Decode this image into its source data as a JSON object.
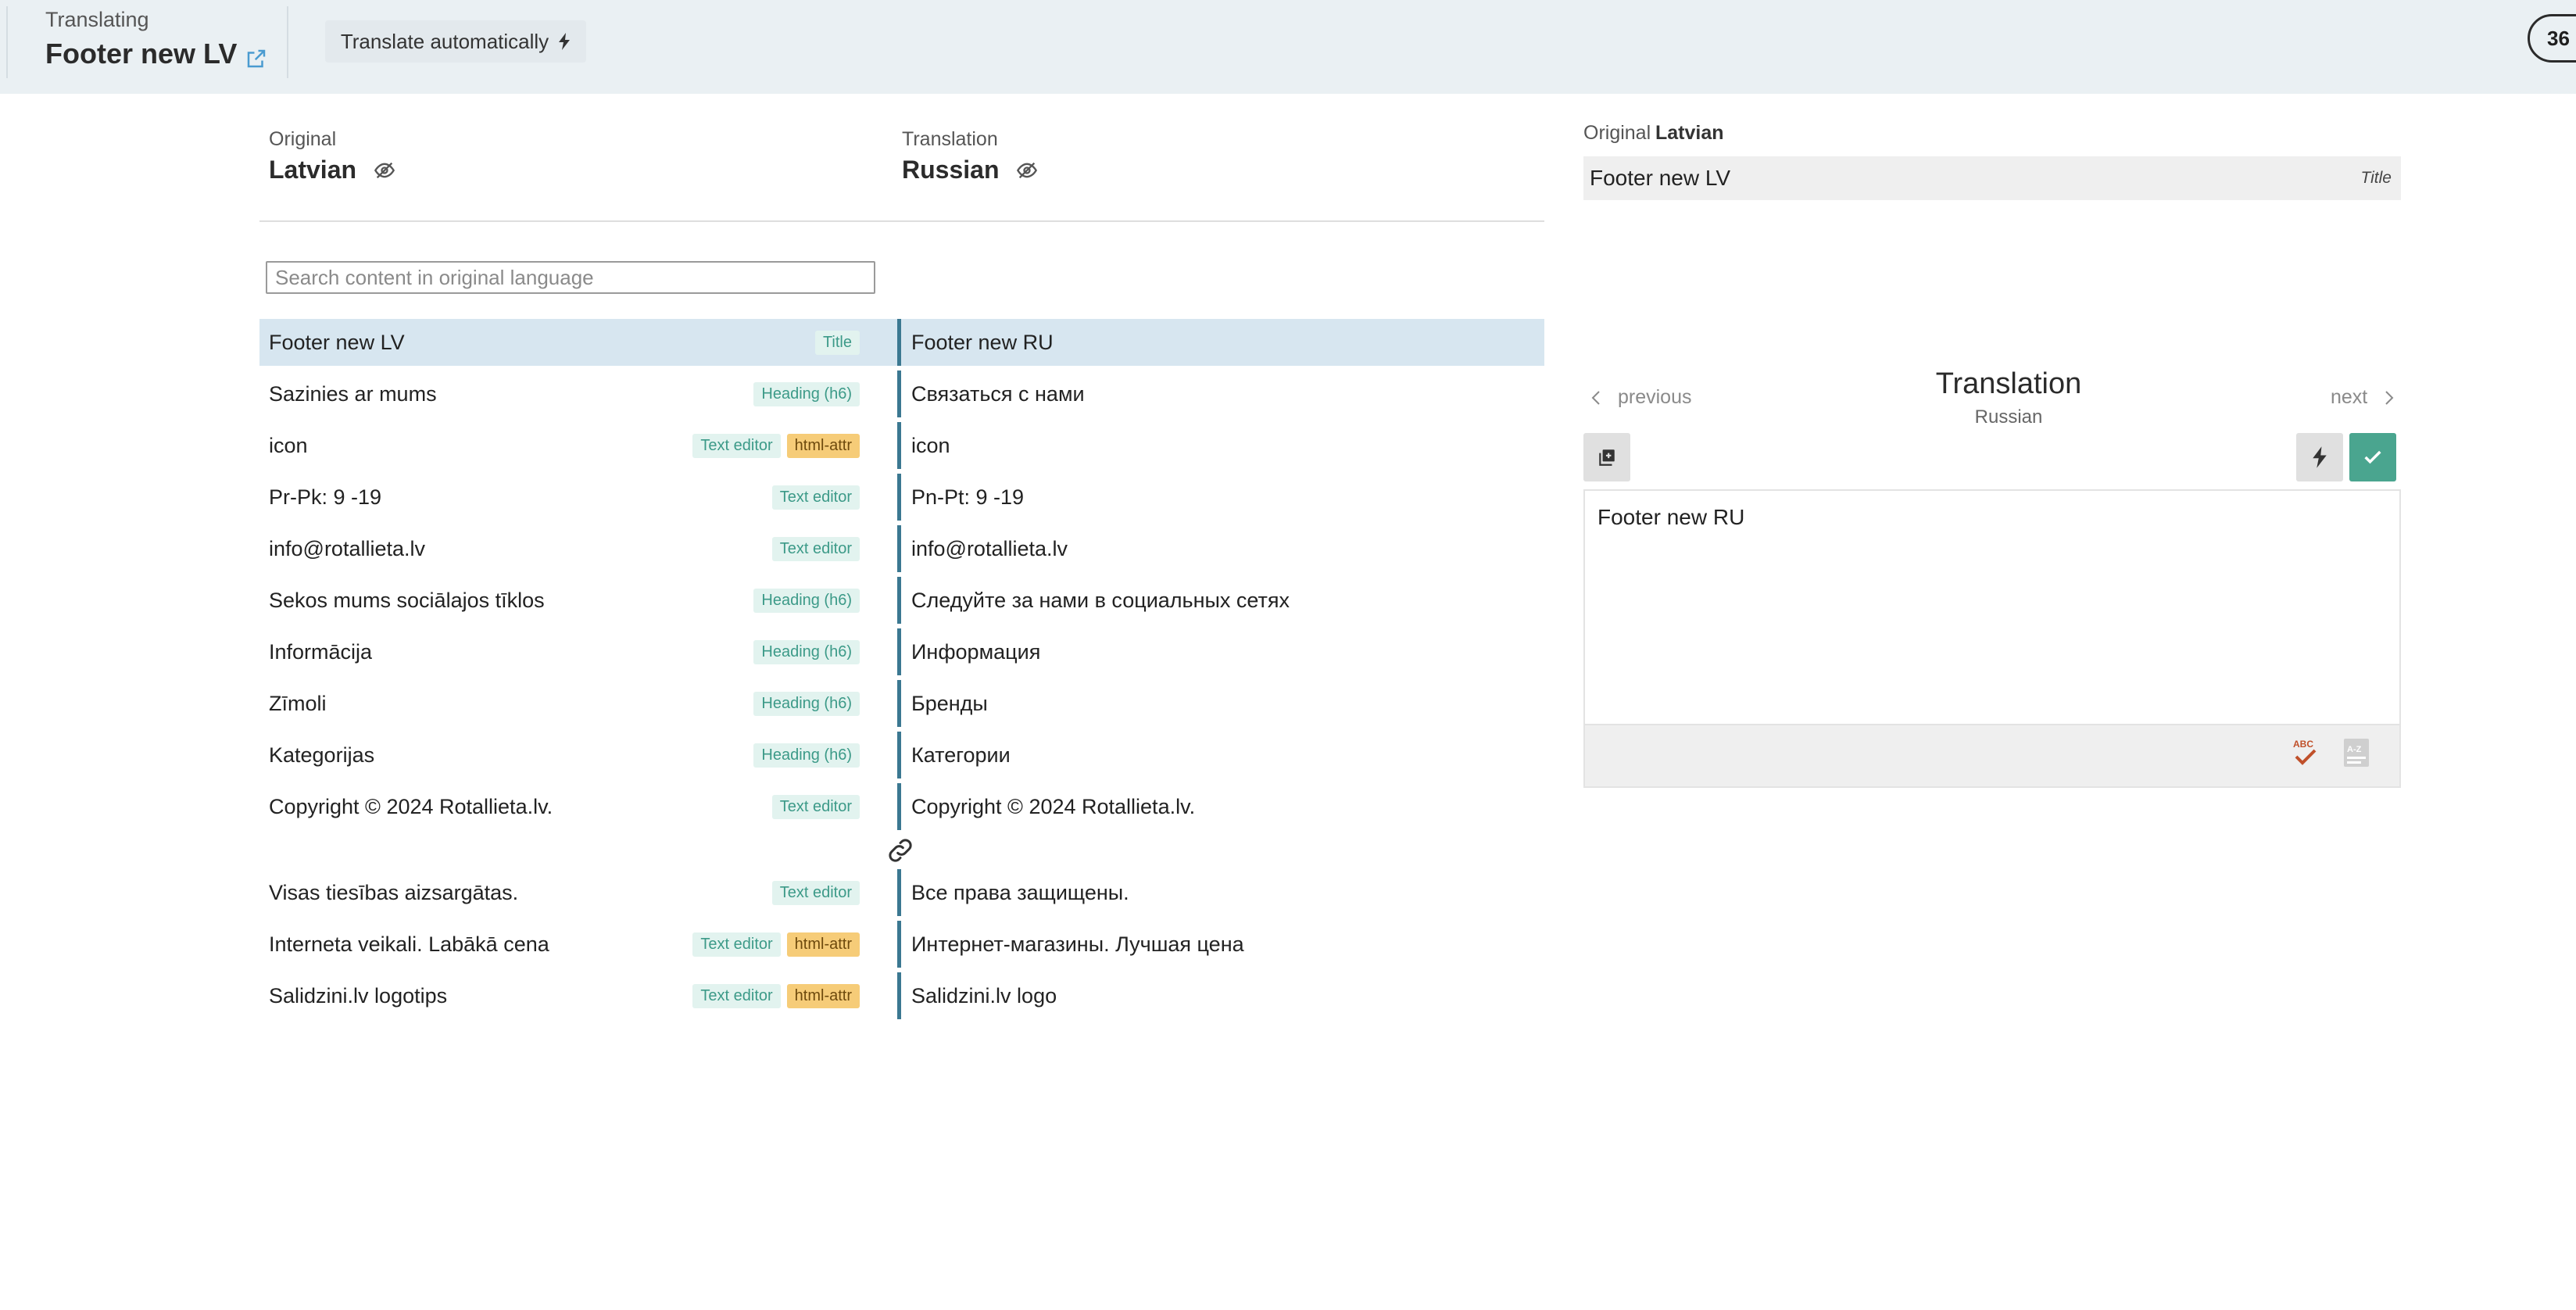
{
  "header": {
    "label": "Translating",
    "title": "Footer new LV",
    "translate_auto_label": "Translate automatically",
    "count_badge": "36"
  },
  "columns": {
    "original": {
      "label": "Original",
      "language": "Latvian"
    },
    "translation": {
      "label": "Translation",
      "language": "Russian"
    }
  },
  "search": {
    "placeholder": "Search content in original language",
    "value": ""
  },
  "rows": [
    {
      "original": "Footer new LV",
      "tags": [
        "Title"
      ],
      "translation": "Footer new RU",
      "selected": true
    },
    {
      "original": "Sazinies ar mums",
      "tags": [
        "Heading (h6)"
      ],
      "translation": "Связаться с нами"
    },
    {
      "original": "icon",
      "tags": [
        "Text editor",
        "html-attr"
      ],
      "translation": "icon"
    },
    {
      "original": "Pr-Pk: 9 -19",
      "tags": [
        "Text editor"
      ],
      "translation": "Pn-Pt: 9 -19"
    },
    {
      "original": "info@rotallieta.lv",
      "tags": [
        "Text editor"
      ],
      "translation": "info@rotallieta.lv"
    },
    {
      "original": "Sekos mums sociālajos tīklos",
      "tags": [
        "Heading (h6)"
      ],
      "translation": "Следуйте за нами в социальных сетях"
    },
    {
      "original": "Informācija",
      "tags": [
        "Heading (h6)"
      ],
      "translation": "Информация"
    },
    {
      "original": "Zīmoli",
      "tags": [
        "Heading (h6)"
      ],
      "translation": "Бренды"
    },
    {
      "original": "Kategorijas",
      "tags": [
        "Heading (h6)"
      ],
      "translation": "Категории"
    },
    {
      "original": "Copyright © 2024 Rotallieta.lv.",
      "tags": [
        "Text editor"
      ],
      "translation": "Copyright © 2024 Rotallieta.lv."
    },
    {
      "original": "Visas tiesības aizsargātas.",
      "tags": [
        "Text editor"
      ],
      "translation": "Все права защищены."
    },
    {
      "original": "Interneta veikali. Labākā cena",
      "tags": [
        "Text editor",
        "html-attr"
      ],
      "translation": "Интернет-магазины. Лучшая цена"
    },
    {
      "original": "Salidzini.lv logotips",
      "tags": [
        "Text editor",
        "html-attr"
      ],
      "translation": "Salidzini.lv logo"
    }
  ],
  "panel": {
    "original_label": "Original",
    "original_language": "Latvian",
    "original_text": "Footer new LV",
    "original_type": "Title",
    "prev_label": "previous",
    "next_label": "next",
    "heading": "Translation",
    "language": "Russian",
    "editor_value": "Footer new RU"
  },
  "colors": {
    "topbar": "#eaf0f3",
    "selected_row": "#d7e6f0",
    "divider": "#3b7891",
    "tag_text_editor": "#e2f3ef",
    "tag_html_attr": "#f6cc78",
    "confirm": "#4aa58f"
  },
  "icons": {
    "external_link": "external-link-icon",
    "visibility": "eye-slash-icon",
    "copy": "copy-icon",
    "auto_translate": "bolt-icon",
    "confirm": "check-icon",
    "spellcheck": "spellcheck-icon",
    "sort": "sort-az-icon",
    "link": "link-icon"
  }
}
